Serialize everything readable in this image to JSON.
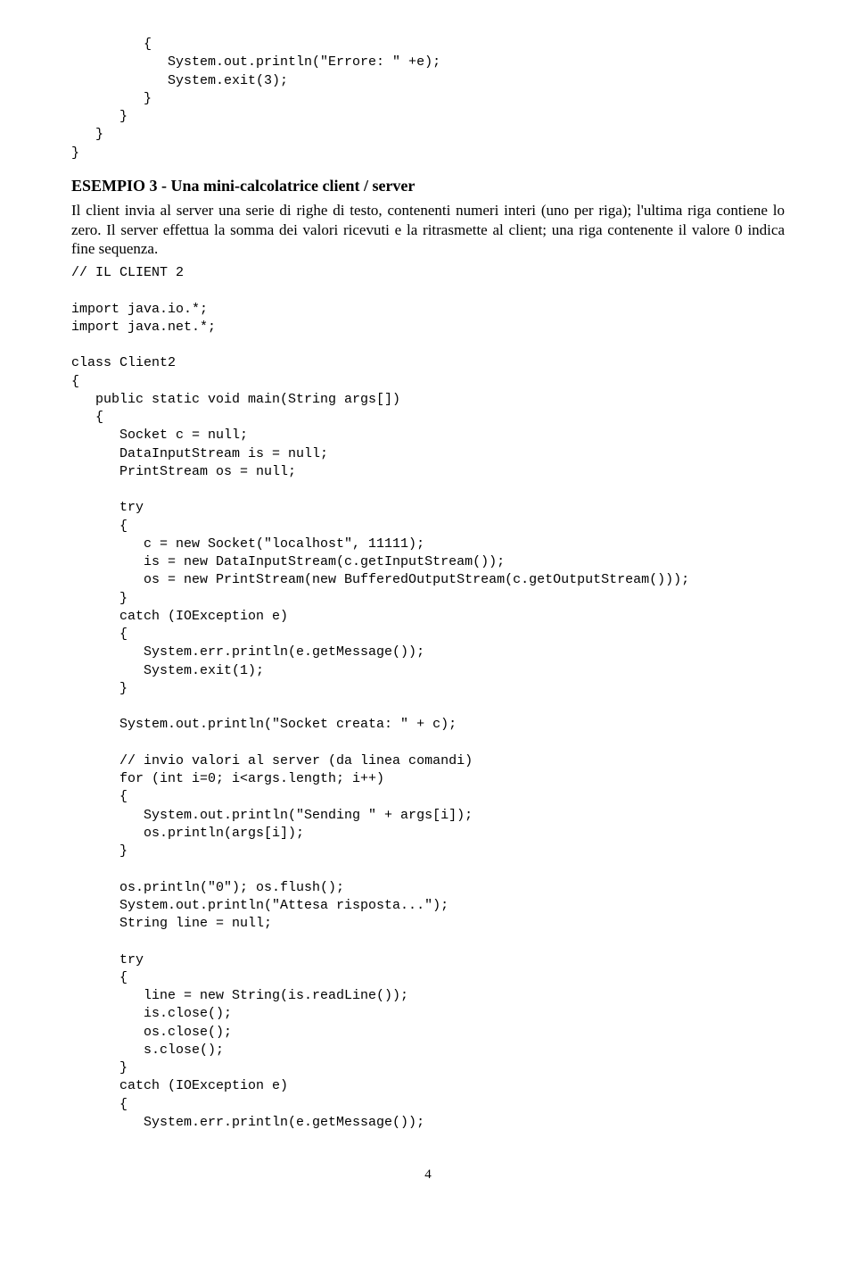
{
  "code_block_top": "         {\n            System.out.println(\"Errore: \" +e);\n            System.exit(3);\n         }\n      }\n   }\n}",
  "heading": "ESEMPIO 3 - Una mini-calcolatrice client / server",
  "paragraph": "Il client invia al server una serie di righe di testo, contenenti numeri interi (uno per riga); l'ultima riga contiene lo zero. Il server effettua la somma dei valori ricevuti e la ritrasmette al client; una riga contenente il valore 0 indica fine sequenza.",
  "code_block_main": "// IL CLIENT 2\n\nimport java.io.*;\nimport java.net.*;\n\nclass Client2\n{\n   public static void main(String args[])\n   {\n      Socket c = null;\n      DataInputStream is = null;\n      PrintStream os = null;\n\n      try\n      {\n         c = new Socket(\"localhost\", 11111);\n         is = new DataInputStream(c.getInputStream());\n         os = new PrintStream(new BufferedOutputStream(c.getOutputStream()));\n      }\n      catch (IOException e)\n      {\n         System.err.println(e.getMessage());\n         System.exit(1);\n      }\n\n      System.out.println(\"Socket creata: \" + c);\n\n      // invio valori al server (da linea comandi)\n      for (int i=0; i<args.length; i++)\n      {\n         System.out.println(\"Sending \" + args[i]);\n         os.println(args[i]);\n      }\n\n      os.println(\"0\"); os.flush();\n      System.out.println(\"Attesa risposta...\");\n      String line = null;\n\n      try\n      {\n         line = new String(is.readLine());\n         is.close();\n         os.close();\n         s.close();\n      }\n      catch (IOException e)\n      {\n         System.err.println(e.getMessage());",
  "page_number": "4"
}
